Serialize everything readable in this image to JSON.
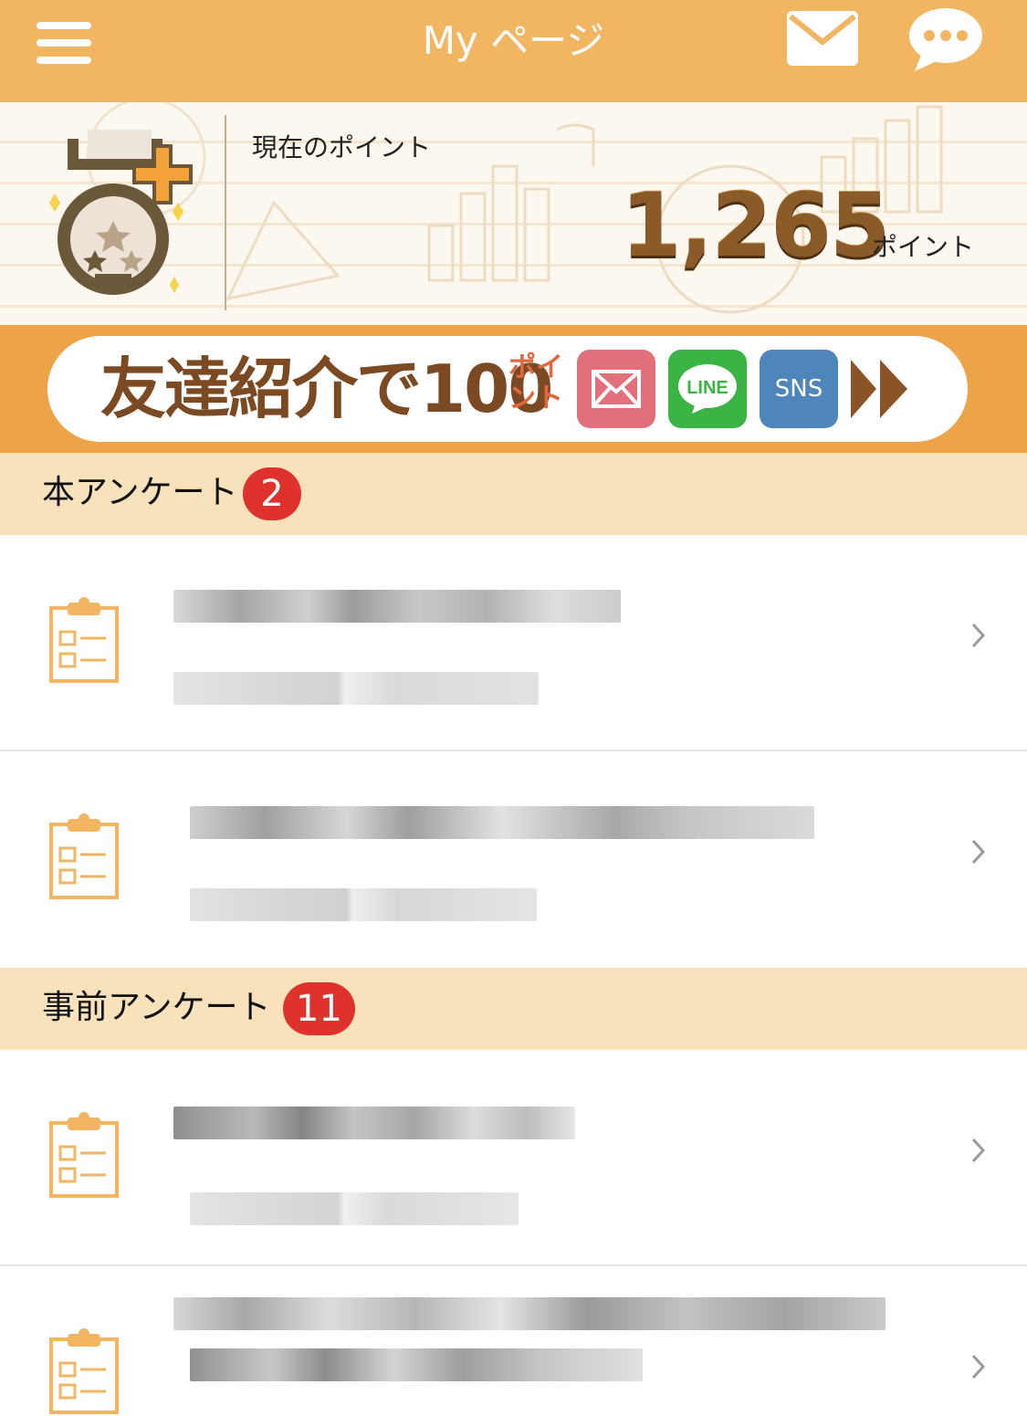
{
  "header": {
    "title": "My ページ",
    "menu_icon": "hamburger-menu-icon",
    "mail_icon": "mail-icon",
    "chat_icon": "chat-bubble-icon"
  },
  "points": {
    "label": "現在のポイント",
    "value": "1,265",
    "unit": "ポイント"
  },
  "banner": {
    "text": "友達紹介で100",
    "small_text": "ポイント",
    "line_label": "LINE",
    "sns_label": "SNS"
  },
  "sections": [
    {
      "title": "本アンケート",
      "badge": "2"
    },
    {
      "title": "事前アンケート",
      "badge": "11"
    }
  ],
  "colors": {
    "header": "#f2b562",
    "section_bg": "#f8e2bb",
    "badge": "#e0322d",
    "brown": "#8a5a28"
  }
}
